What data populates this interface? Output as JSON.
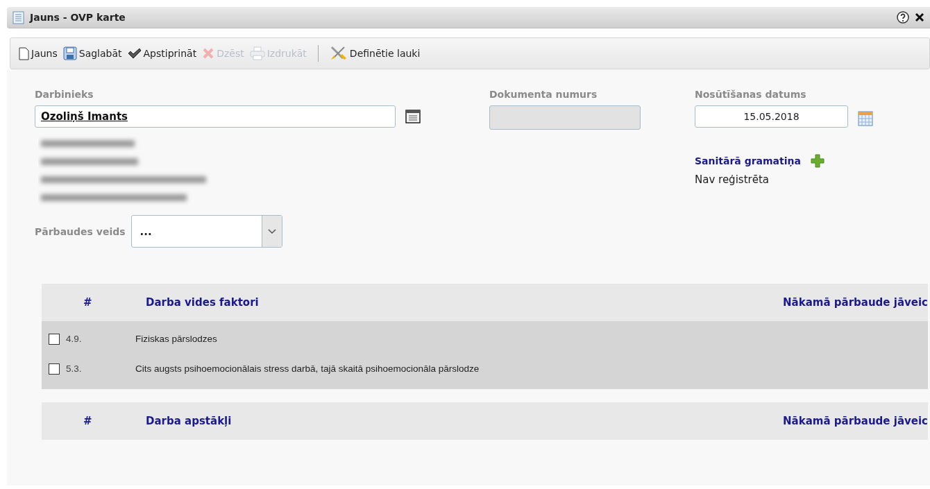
{
  "window": {
    "title": "Jauns - OVP karte"
  },
  "toolbar": [
    {
      "kind": "new",
      "label": "Jauns",
      "disabled": false,
      "separator_before": false
    },
    {
      "kind": "save",
      "label": "Saglabāt",
      "disabled": false,
      "separator_before": false
    },
    {
      "kind": "approve",
      "label": "Apstiprināt",
      "disabled": false,
      "separator_before": false
    },
    {
      "kind": "delete",
      "label": "Dzēst",
      "disabled": true,
      "separator_before": false
    },
    {
      "kind": "print",
      "label": "Izdrukāt",
      "disabled": true,
      "separator_before": false
    },
    {
      "kind": "fields",
      "label": "Definētie lauki",
      "disabled": false,
      "separator_before": true
    }
  ],
  "form": {
    "employee": {
      "label": "Darbinieks",
      "value": "Ozoliņš Imants"
    },
    "document_number": {
      "label": "Dokumenta numurs"
    },
    "date": {
      "label": "Nosūtīšanas datums",
      "value": "15.05.2018"
    },
    "sanitary_book": {
      "label": "Sanitārā gramatiņa",
      "status": "Nav reģistrēta"
    },
    "check_type": {
      "label": "Pārbaudes veids",
      "value": "..."
    }
  },
  "tables": [
    {
      "columns": [
        "#",
        "Darba vides faktori",
        "Nākamā pārbaude jāveic"
      ],
      "rows": [
        {
          "checked": false,
          "number": "4.9.",
          "name": "Fiziskas pārslodzes"
        },
        {
          "checked": false,
          "number": "5.3.",
          "name": "Cits augsts psihoemocionālais stress darbā, tajā skaitā psihoemocionāla pārslodze"
        }
      ]
    },
    {
      "columns": [
        "#",
        "Darba apstākļi",
        "Nākamā pārbaude jāveic"
      ]
    }
  ]
}
